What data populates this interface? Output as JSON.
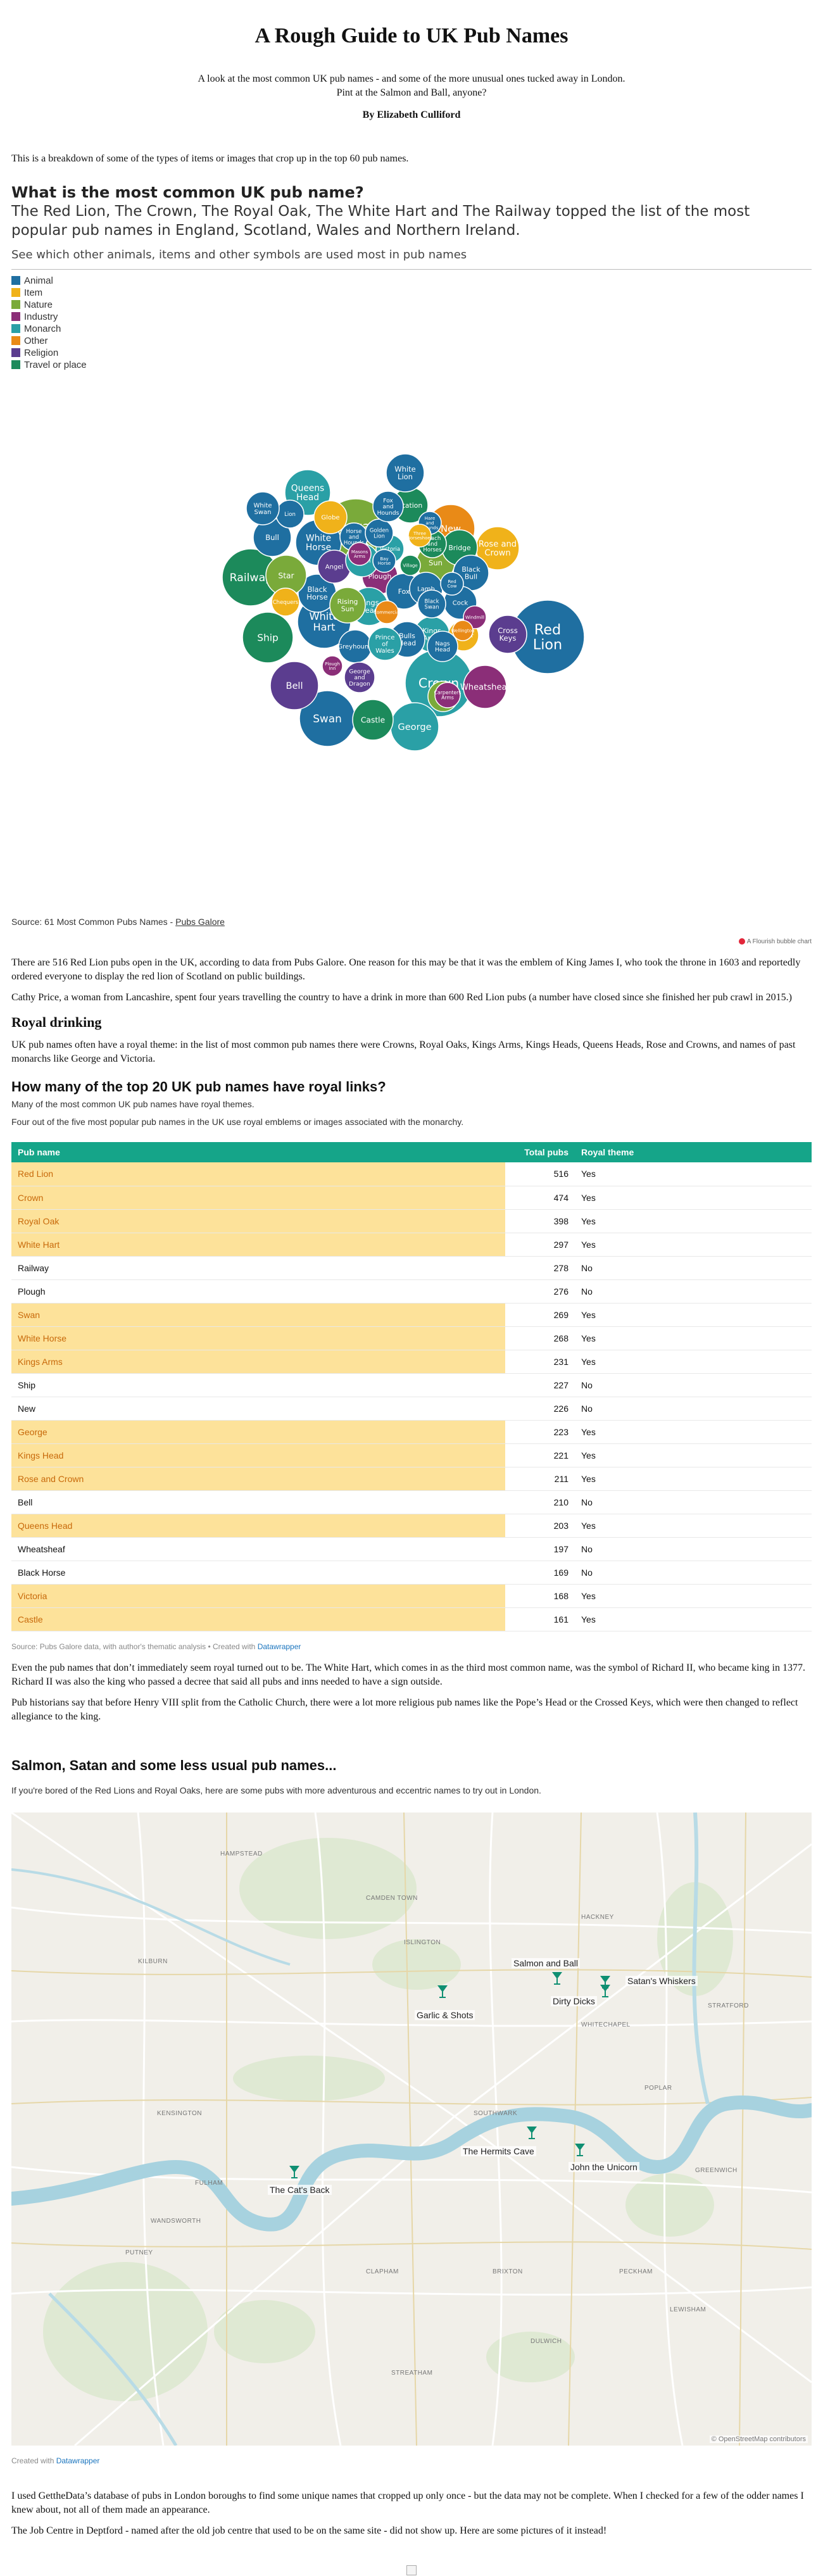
{
  "header": {
    "title": "A Rough Guide to UK Pub Names",
    "intro_line1": "A look at the most common UK pub names - and some of the more unusual ones tucked away in London.",
    "intro_line2": "Pint at the Salmon and Ball, anyone?",
    "byline": "By Elizabeth Culliford"
  },
  "intro_paragraph": "This is a breakdown of some of the types of items or images that crop up in the top 60 pub names.",
  "bubble_chart": {
    "title": "What is the most common UK pub name?",
    "subtitle": "The Red Lion, The Crown, The Royal Oak, The White Hart and The Railway topped the list of the most popular pub names in England, Scotland, Wales and Northern Ireland.",
    "subtitle2": "See which other animals, items and other symbols are used most in pub names",
    "legend": [
      {
        "label": "Animal",
        "color": "#1f6fa1"
      },
      {
        "label": "Item",
        "color": "#f0b21a"
      },
      {
        "label": "Nature",
        "color": "#7aaa3a"
      },
      {
        "label": "Industry",
        "color": "#8b2e78"
      },
      {
        "label": "Monarch",
        "color": "#2aa0a6"
      },
      {
        "label": "Other",
        "color": "#e98a17"
      },
      {
        "label": "Religion",
        "color": "#5b3d8f"
      },
      {
        "label": "Travel or place",
        "color": "#1c8a5b"
      }
    ],
    "bubbles": [
      {
        "name": "Red Lion",
        "category": "Animal"
      },
      {
        "name": "Crown",
        "category": "Monarch"
      },
      {
        "name": "Royal Oak",
        "category": "Nature"
      },
      {
        "name": "White Hart",
        "category": "Animal"
      },
      {
        "name": "Railway",
        "category": "Travel or place"
      },
      {
        "name": "Plough",
        "category": "Industry"
      },
      {
        "name": "Swan",
        "category": "Animal"
      },
      {
        "name": "White Horse",
        "category": "Animal"
      },
      {
        "name": "Kings Arms",
        "category": "Monarch"
      },
      {
        "name": "Ship",
        "category": "Travel or place"
      },
      {
        "name": "New",
        "category": "Other"
      },
      {
        "name": "George",
        "category": "Monarch"
      },
      {
        "name": "Kings Head",
        "category": "Monarch"
      },
      {
        "name": "Rose and Crown",
        "category": "Item"
      },
      {
        "name": "Bell",
        "category": "Religion"
      },
      {
        "name": "Queens Head",
        "category": "Monarch"
      },
      {
        "name": "Wheatsheaf",
        "category": "Industry"
      },
      {
        "name": "Black Horse",
        "category": "Animal"
      },
      {
        "name": "Victoria",
        "category": "Monarch"
      },
      {
        "name": "Castle",
        "category": "Travel or place"
      },
      {
        "name": "Star",
        "category": "Nature"
      },
      {
        "name": "Sun",
        "category": "Nature"
      },
      {
        "name": "Fox",
        "category": "Animal"
      },
      {
        "name": "Bull",
        "category": "Animal"
      },
      {
        "name": "Lion",
        "category": "Animal"
      },
      {
        "name": "Anchor",
        "category": "Item"
      },
      {
        "name": "Cross Keys",
        "category": "Religion"
      },
      {
        "name": "Bridge",
        "category": "Travel or place"
      },
      {
        "name": "Station",
        "category": "Travel or place"
      },
      {
        "name": "White Lion",
        "category": "Animal"
      },
      {
        "name": "Globe",
        "category": "Item"
      },
      {
        "name": "Angel",
        "category": "Religion"
      },
      {
        "name": "Black Bull",
        "category": "Animal"
      },
      {
        "name": "Cock",
        "category": "Animal"
      },
      {
        "name": "Lamb",
        "category": "Animal"
      },
      {
        "name": "Royal",
        "category": "Monarch"
      },
      {
        "name": "Bulls Head",
        "category": "Animal"
      },
      {
        "name": "Nags Head",
        "category": "Animal"
      },
      {
        "name": "Blue Bell",
        "category": "Nature"
      },
      {
        "name": "White Swan",
        "category": "Animal"
      },
      {
        "name": "Chequers",
        "category": "Item"
      },
      {
        "name": "Rising Sun",
        "category": "Nature"
      },
      {
        "name": "Greyhound",
        "category": "Animal"
      },
      {
        "name": "George and Dragon",
        "category": "Religion"
      },
      {
        "name": "Prince of Wales",
        "category": "Monarch"
      },
      {
        "name": "Black Swan",
        "category": "Animal"
      },
      {
        "name": "Windmill",
        "category": "Industry"
      },
      {
        "name": "Horse and Hounds",
        "category": "Animal"
      },
      {
        "name": "Golden Lion",
        "category": "Animal"
      },
      {
        "name": "Masons Arms",
        "category": "Industry"
      },
      {
        "name": "Bay Horse",
        "category": "Animal"
      },
      {
        "name": "Village",
        "category": "Travel or place"
      },
      {
        "name": "Coach and Horses",
        "category": "Travel or place"
      },
      {
        "name": "Fox and Hounds",
        "category": "Animal"
      },
      {
        "name": "Hare and Hounds",
        "category": "Animal"
      },
      {
        "name": "Carpenters Arms",
        "category": "Industry"
      },
      {
        "name": "Three Horseshoes",
        "category": "Item"
      },
      {
        "name": "Plough Inn",
        "category": "Industry"
      },
      {
        "name": "Commercial",
        "category": "Other"
      },
      {
        "name": "Red Cow",
        "category": "Animal"
      },
      {
        "name": "Wellington",
        "category": "Other"
      }
    ],
    "source_text": "Source: 61 Most Common Pubs Names - ",
    "source_link": "Pubs Galore",
    "credit": "A Flourish bubble chart"
  },
  "redlion_paragraph1": "There are 516 Red Lion pubs open in the UK, according to data from Pubs Galore. One reason for this may be that it was the emblem of King James I, who took the throne in 1603 and reportedly ordered everyone to display the red lion of Scotland on public buildings.",
  "redlion_paragraph2": "Cathy Price, a woman from Lancashire, spent four years travelling the country to have a drink in more than 600 Red Lion pubs (a number have closed since she finished her pub crawl in 2015.)",
  "royal_heading": "Royal drinking",
  "royal_paragraph": "UK pub names often have a royal theme: in the list of most common pub names there were Crowns, Royal Oaks, Kings Arms, Kings Heads, Queens Heads, Rose and Crowns, and names of past monarchs like George and Victoria.",
  "table_block": {
    "title": "How many of the top 20 UK pub names have royal links?",
    "desc1": "Many of the most common UK pub names have royal themes.",
    "desc2": "Four out of the five most popular pub names in the UK use royal emblems or images associated with the monarchy.",
    "columns": [
      "Pub name",
      "Total pubs",
      "Royal theme"
    ],
    "rows": [
      {
        "name": "Red Lion",
        "total": "516",
        "royal": "Yes"
      },
      {
        "name": "Crown",
        "total": "474",
        "royal": "Yes"
      },
      {
        "name": "Royal Oak",
        "total": "398",
        "royal": "Yes"
      },
      {
        "name": "White Hart",
        "total": "297",
        "royal": "Yes"
      },
      {
        "name": "Railway",
        "total": "278",
        "royal": "No"
      },
      {
        "name": "Plough",
        "total": "276",
        "royal": "No"
      },
      {
        "name": "Swan",
        "total": "269",
        "royal": "Yes"
      },
      {
        "name": "White Horse",
        "total": "268",
        "royal": "Yes"
      },
      {
        "name": "Kings Arms",
        "total": "231",
        "royal": "Yes"
      },
      {
        "name": "Ship",
        "total": "227",
        "royal": "No"
      },
      {
        "name": "New",
        "total": "226",
        "royal": "No"
      },
      {
        "name": "George",
        "total": "223",
        "royal": "Yes"
      },
      {
        "name": "Kings Head",
        "total": "221",
        "royal": "Yes"
      },
      {
        "name": "Rose and Crown",
        "total": "211",
        "royal": "Yes"
      },
      {
        "name": "Bell",
        "total": "210",
        "royal": "No"
      },
      {
        "name": "Queens Head",
        "total": "203",
        "royal": "Yes"
      },
      {
        "name": "Wheatsheaf",
        "total": "197",
        "royal": "No"
      },
      {
        "name": "Black Horse",
        "total": "169",
        "royal": "No"
      },
      {
        "name": "Victoria",
        "total": "168",
        "royal": "Yes"
      },
      {
        "name": "Castle",
        "total": "161",
        "royal": "Yes"
      }
    ],
    "source_text": "Source: Pubs Galore data, with author's thematic analysis • Created with ",
    "source_link": "Datawrapper"
  },
  "whitehart_paragraph": "Even the pub names that don’t immediately seem royal turned out to be. The White Hart, which comes in as the third most common name, was the symbol of Richard II, who became king in 1377. Richard II was also the king who passed a decree that said all pubs and inns needed to have a sign outside.",
  "henry_paragraph": "Pub historians say that before Henry VIII split from the Catholic Church, there were a lot more religious pub names like the Pope’s Head or the Crossed Keys, which were then changed to reflect allegiance to the king.",
  "map_block": {
    "title": "Salmon, Satan and some less usual pub names...",
    "desc": "If you're bored of the Red Lions and Royal Oaks, here are some pubs with more adventurous and eccentric names to try out in London.",
    "pubs": [
      "Salmon and Ball",
      "Satan's Whiskers",
      "Dirty Dicks",
      "Garlic & Shots",
      "The Hermits Cave",
      "John the Unicorn",
      "The Cat's Back"
    ],
    "areas": [
      "HAMPSTEAD",
      "KILBURN",
      "ISLINGTON",
      "HACKNEY",
      "STRATFORD",
      "KENSINGTON",
      "BRIXTON",
      "WANDSWORTH",
      "PECKHAM",
      "LEWISHAM",
      "GREENWICH",
      "CLAPHAM",
      "FULHAM",
      "PUTNEY",
      "CAMDEN TOWN",
      "SOUTHWARK",
      "WHITECHAPEL",
      "POPLAR",
      "DULWICH",
      "STREATHAM"
    ],
    "attribution": "© OpenStreetMap contributors",
    "created_text": "Created with ",
    "created_link": "Datawrapper"
  },
  "final_paragraph1": "I used GettheData’s database of pubs in London boroughs to find some unique names that cropped up only once - but the data may not be complete. When I checked for a few of the odder names I knew about, not all of them made an appearance.",
  "final_paragraph2": "The Job Centre in Deptford - named after the old job centre that used to be on the same site - did not show up. Here are some pictures of it instead!"
}
